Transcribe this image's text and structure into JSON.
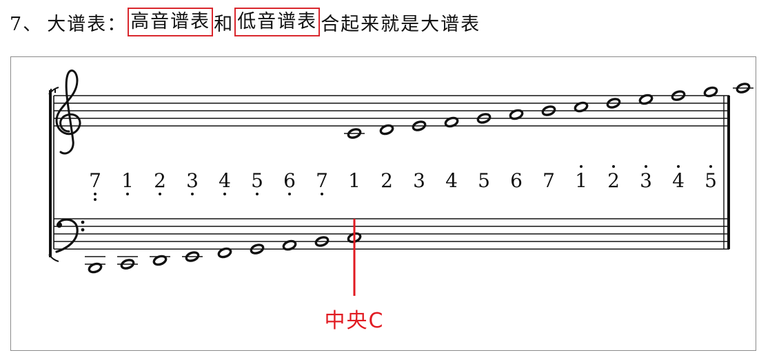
{
  "heading": {
    "number": "7、",
    "lead": "大谱表：",
    "treble_box": "高音谱表",
    "connector": "和",
    "bass_box": "低音谱表",
    "tail": "合起来就是大谱表"
  },
  "score": {
    "jianpu_digits": [
      "7",
      "1",
      "2",
      "3",
      "4",
      "5",
      "6",
      "7",
      "1",
      "2",
      "3",
      "4",
      "5",
      "6",
      "7",
      "1",
      "2",
      "3",
      "4",
      "5"
    ],
    "dots_below": [
      2,
      1,
      1,
      1,
      1,
      1,
      1,
      1,
      0,
      0,
      0,
      0,
      0,
      0,
      0,
      0,
      0,
      0,
      0,
      0
    ],
    "dots_above": [
      0,
      0,
      0,
      0,
      0,
      0,
      0,
      0,
      0,
      0,
      0,
      0,
      0,
      0,
      0,
      1,
      1,
      1,
      1,
      1
    ],
    "bass_notes": [
      "B1",
      "C2",
      "D2",
      "E2",
      "F2",
      "G2",
      "A2",
      "B2",
      "C3"
    ],
    "treble_notes": [
      "C4",
      "D4",
      "E4",
      "F4",
      "G4",
      "A4",
      "B4",
      "C5",
      "D5",
      "E5",
      "F5",
      "G5",
      "A5",
      "B5",
      "C6"
    ],
    "middle_c_label": "中央C",
    "colors": {
      "highlight": "#d9262c",
      "label": "#e11b22",
      "ink": "#111111"
    }
  }
}
